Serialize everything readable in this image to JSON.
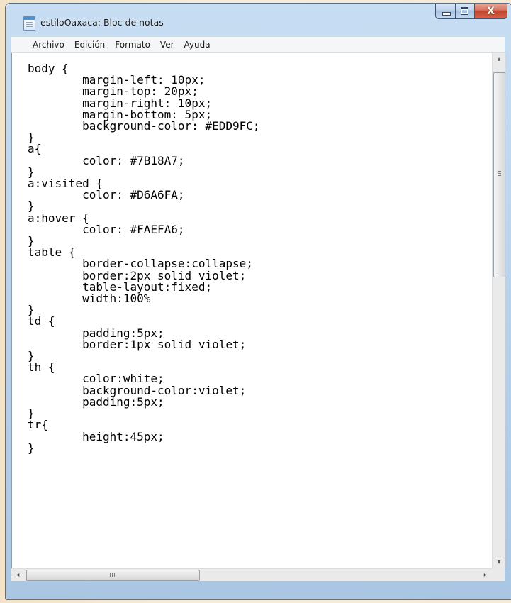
{
  "window": {
    "title": "estiloOaxaca: Bloc de notas",
    "app_icon": "notepad-icon",
    "controls": {
      "minimize": "minimize-icon",
      "maximize": "maximize-icon",
      "close": "close-icon",
      "close_glyph": "X"
    }
  },
  "menu": [
    {
      "label": "Archivo"
    },
    {
      "label": "Edición"
    },
    {
      "label": "Formato"
    },
    {
      "label": "Ver"
    },
    {
      "label": "Ayuda"
    }
  ],
  "editor": {
    "content": "body {\n        margin-left: 10px;\n        margin-top: 20px;\n        margin-right: 10px;\n        margin-bottom: 5px;\n        background-color: #EDD9FC;\n}\na{\n        color: #7B18A7;\n}\na:visited {\n        color: #D6A6FA;\n}\na:hover {\n        color: #FAEFA6;\n}\ntable {\n        border-collapse:collapse;\n        border:2px solid violet;\n        table-layout:fixed;\n        width:100%\n}\ntd {\n        padding:5px;\n        border:1px solid violet;\n}\nth {\n        color:white;\n        background-color:violet;\n        padding:5px;\n}\ntr{\n        height:45px;\n}"
  },
  "scrollbars": {
    "vertical": {
      "up_arrow": "▲",
      "down_arrow": "▼",
      "thumb_grip": "≡"
    },
    "horizontal": {
      "left_arrow": "◀",
      "right_arrow": "▶",
      "thumb_grip": "|||"
    }
  },
  "colors": {
    "frame": "#b6d0ea",
    "close_button": "#c0432c",
    "editor_background": "#ffffff"
  }
}
